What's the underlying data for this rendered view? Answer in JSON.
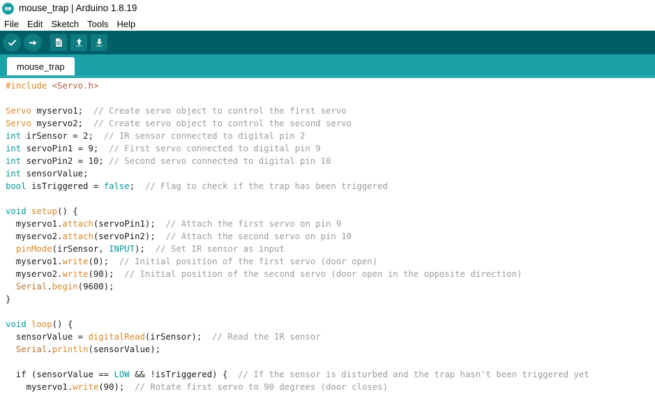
{
  "window": {
    "title": "mouse_trap | Arduino 1.8.19",
    "app_icon": "arduino-logo-icon"
  },
  "menubar": {
    "items": [
      {
        "label": "File",
        "name": "menu-file"
      },
      {
        "label": "Edit",
        "name": "menu-edit"
      },
      {
        "label": "Sketch",
        "name": "menu-sketch"
      },
      {
        "label": "Tools",
        "name": "menu-tools"
      },
      {
        "label": "Help",
        "name": "menu-help"
      }
    ]
  },
  "toolbar": {
    "background": "#005f66",
    "button_background": "#0e7b80",
    "buttons": [
      {
        "name": "verify-button",
        "icon": "checkmark-icon",
        "shape": "round"
      },
      {
        "name": "upload-button",
        "icon": "arrow-right-icon",
        "shape": "round"
      },
      {
        "name": "new-sketch-button",
        "icon": "new-page-icon",
        "shape": "square"
      },
      {
        "name": "open-sketch-button",
        "icon": "arrow-up-icon",
        "shape": "square"
      },
      {
        "name": "save-sketch-button",
        "icon": "arrow-down-icon",
        "shape": "square"
      }
    ]
  },
  "tabstrip": {
    "background": "#1ba2a8",
    "tabs": [
      {
        "label": "mouse_trap",
        "active": true
      }
    ]
  },
  "editor": {
    "colors": {
      "preprocessor": "#d9882a",
      "include_path": "#b85c3c",
      "keyword": "#00979c",
      "function": "#d9882a",
      "object": "#c07030",
      "comment": "#9b9b9b",
      "text": "#1a1a1a",
      "background": "#ffffff"
    },
    "lines": [
      [
        {
          "t": "#include ",
          "c": "pre"
        },
        {
          "t": "<Servo.h>",
          "c": "inc"
        }
      ],
      [],
      [
        {
          "t": "Servo",
          "c": "type"
        },
        {
          "t": " myservo1;  ",
          "c": "txt"
        },
        {
          "t": "// Create servo object to control the first servo",
          "c": "cmt"
        }
      ],
      [
        {
          "t": "Servo",
          "c": "type"
        },
        {
          "t": " myservo2;  ",
          "c": "txt"
        },
        {
          "t": "// Create servo object to control the second servo",
          "c": "cmt"
        }
      ],
      [
        {
          "t": "int",
          "c": "kw"
        },
        {
          "t": " irSensor = 2;  ",
          "c": "txt"
        },
        {
          "t": "// IR sensor connected to digital pin 2",
          "c": "cmt"
        }
      ],
      [
        {
          "t": "int",
          "c": "kw"
        },
        {
          "t": " servoPin1 = 9;  ",
          "c": "txt"
        },
        {
          "t": "// First servo connected to digital pin 9",
          "c": "cmt"
        }
      ],
      [
        {
          "t": "int",
          "c": "kw"
        },
        {
          "t": " servoPin2 = 10; ",
          "c": "txt"
        },
        {
          "t": "// Second servo connected to digital pin 10",
          "c": "cmt"
        }
      ],
      [
        {
          "t": "int",
          "c": "kw"
        },
        {
          "t": " sensorValue;",
          "c": "txt"
        }
      ],
      [
        {
          "t": "bool",
          "c": "kw"
        },
        {
          "t": " isTriggered = ",
          "c": "txt"
        },
        {
          "t": "false",
          "c": "kw"
        },
        {
          "t": ";  ",
          "c": "txt"
        },
        {
          "t": "// Flag to check if the trap has been triggered",
          "c": "cmt"
        }
      ],
      [],
      [
        {
          "t": "void",
          "c": "kw"
        },
        {
          "t": " ",
          "c": "txt"
        },
        {
          "t": "setup",
          "c": "fn"
        },
        {
          "t": "() {",
          "c": "txt"
        }
      ],
      [
        {
          "t": "  myservo1.",
          "c": "txt"
        },
        {
          "t": "attach",
          "c": "fn"
        },
        {
          "t": "(servoPin1);  ",
          "c": "txt"
        },
        {
          "t": "// Attach the first servo on pin 9",
          "c": "cmt"
        }
      ],
      [
        {
          "t": "  myservo2.",
          "c": "txt"
        },
        {
          "t": "attach",
          "c": "fn"
        },
        {
          "t": "(servoPin2);  ",
          "c": "txt"
        },
        {
          "t": "// Attach the second servo on pin 10",
          "c": "cmt"
        }
      ],
      [
        {
          "t": "  ",
          "c": "txt"
        },
        {
          "t": "pinMode",
          "c": "fn"
        },
        {
          "t": "(irSensor, ",
          "c": "txt"
        },
        {
          "t": "INPUT",
          "c": "kw"
        },
        {
          "t": ");  ",
          "c": "txt"
        },
        {
          "t": "// Set IR sensor as input",
          "c": "cmt"
        }
      ],
      [
        {
          "t": "  myservo1.",
          "c": "txt"
        },
        {
          "t": "write",
          "c": "fn"
        },
        {
          "t": "(0);  ",
          "c": "txt"
        },
        {
          "t": "// Initial position of the first servo (door open)",
          "c": "cmt"
        }
      ],
      [
        {
          "t": "  myservo2.",
          "c": "txt"
        },
        {
          "t": "write",
          "c": "fn"
        },
        {
          "t": "(90);  ",
          "c": "txt"
        },
        {
          "t": "// Initial position of the second servo (door open in the opposite direction)",
          "c": "cmt"
        }
      ],
      [
        {
          "t": "  ",
          "c": "txt"
        },
        {
          "t": "Serial",
          "c": "obj"
        },
        {
          "t": ".",
          "c": "txt"
        },
        {
          "t": "begin",
          "c": "fn"
        },
        {
          "t": "(9600);",
          "c": "txt"
        }
      ],
      [
        {
          "t": "}",
          "c": "txt"
        }
      ],
      [],
      [
        {
          "t": "void",
          "c": "kw"
        },
        {
          "t": " ",
          "c": "txt"
        },
        {
          "t": "loop",
          "c": "fn"
        },
        {
          "t": "() {",
          "c": "txt"
        }
      ],
      [
        {
          "t": "  sensorValue = ",
          "c": "txt"
        },
        {
          "t": "digitalRead",
          "c": "fn"
        },
        {
          "t": "(irSensor);  ",
          "c": "txt"
        },
        {
          "t": "// Read the IR sensor",
          "c": "cmt"
        }
      ],
      [
        {
          "t": "  ",
          "c": "txt"
        },
        {
          "t": "Serial",
          "c": "obj"
        },
        {
          "t": ".",
          "c": "txt"
        },
        {
          "t": "println",
          "c": "fn"
        },
        {
          "t": "(sensorValue);",
          "c": "txt"
        }
      ],
      [],
      [
        {
          "t": "  if (sensorValue == ",
          "c": "txt"
        },
        {
          "t": "LOW",
          "c": "kw"
        },
        {
          "t": " && !isTriggered) {  ",
          "c": "txt"
        },
        {
          "t": "// If the sensor is disturbed and the trap hasn't been triggered yet",
          "c": "cmt"
        }
      ],
      [
        {
          "t": "    myservo1.",
          "c": "txt"
        },
        {
          "t": "write",
          "c": "fn"
        },
        {
          "t": "(90);  ",
          "c": "txt"
        },
        {
          "t": "// Rotate first servo to 90 degrees (door closes)",
          "c": "cmt"
        }
      ]
    ]
  }
}
